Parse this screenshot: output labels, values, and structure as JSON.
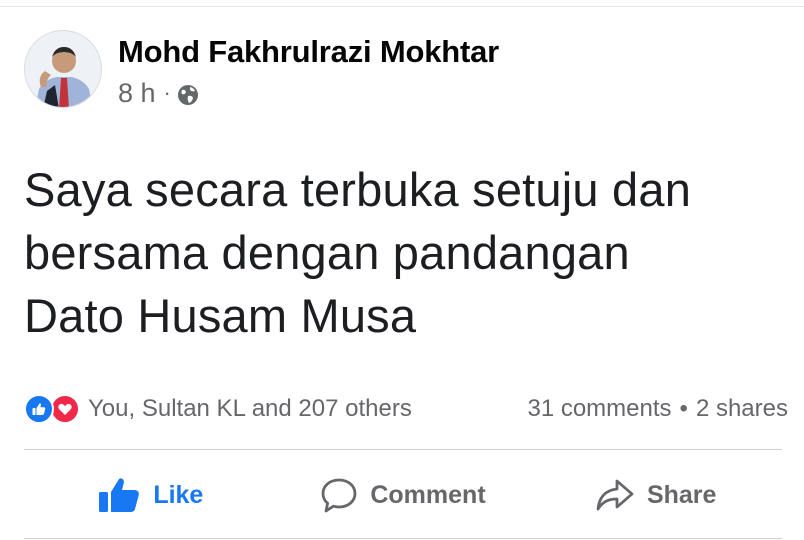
{
  "post": {
    "author": "Mohd Fakhrulrazi Mokhtar",
    "time": "8 h",
    "separator": "·",
    "privacy_icon": "globe-icon",
    "text_lines": [
      "Saya secara terbuka setuju dan",
      "bersama dengan pandangan",
      "Dato Husam Musa"
    ]
  },
  "stats": {
    "reaction_icons": [
      "like-reaction-icon",
      "love-reaction-icon"
    ],
    "reactors": "You, Sultan KL and 207 others",
    "comments": "31 comments",
    "separator": "•",
    "shares": "2 shares"
  },
  "actions": {
    "like": "Like",
    "comment": "Comment",
    "share": "Share"
  },
  "colors": {
    "like_blue": "#1877f2",
    "love_red": "#f02849",
    "secondary_text": "#65676b",
    "primary_text": "#050505"
  }
}
